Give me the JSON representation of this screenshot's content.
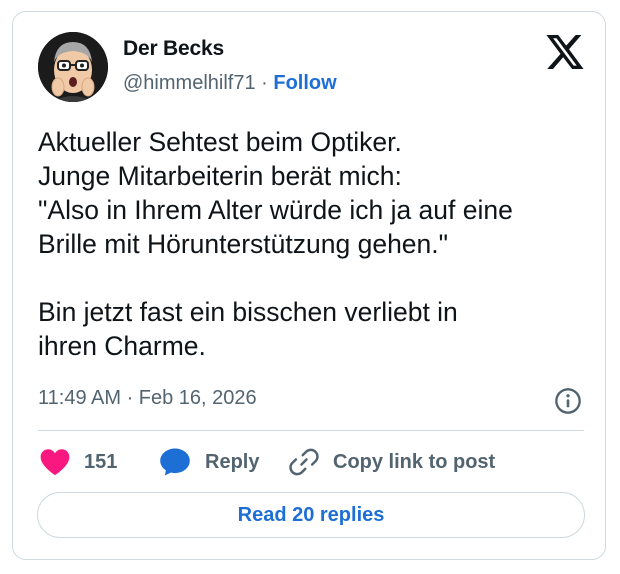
{
  "author": {
    "display_name": "Der Becks",
    "handle": "@himmelhilf71",
    "separator": "·",
    "follow_label": "Follow"
  },
  "tweet": {
    "lines": [
      "Aktueller Sehtest beim Optiker.",
      "Junge Mitarbeiterin berät mich:",
      "\"Also in Ihrem Alter würde ich ja auf eine",
      "Brille mit Hörunterstützung gehen.\"",
      "Bin jetzt fast ein bisschen verliebt in",
      "ihren Charme."
    ],
    "timestamp": "11:49 AM · Feb 16, 2026"
  },
  "actions": {
    "like_count": "151",
    "reply_label": "Reply",
    "copy_label": "Copy link to post",
    "read_replies_label": "Read 20 replies"
  },
  "icons": {
    "brand": "x-logo-icon",
    "info": "info-icon",
    "like": "heart-icon",
    "reply": "speech-bubble-icon",
    "copy": "link-icon"
  },
  "colors": {
    "accent": "#1d6fd6",
    "like": "#f91880",
    "muted": "#536471",
    "text": "#0f1419",
    "border": "#cfd9de"
  }
}
